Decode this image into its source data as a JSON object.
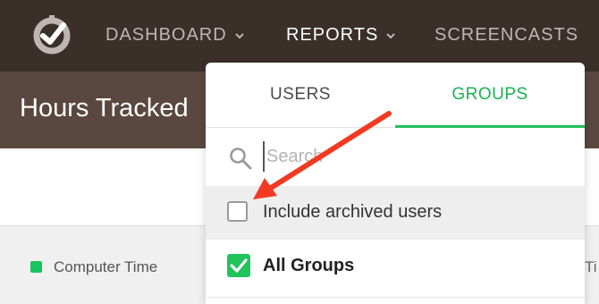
{
  "nav": {
    "items": [
      {
        "label": "DASHBOARD",
        "has_dropdown": true,
        "active": false
      },
      {
        "label": "REPORTS",
        "has_dropdown": true,
        "active": true
      },
      {
        "label": "SCREENCASTS",
        "has_dropdown": false,
        "active": false
      }
    ]
  },
  "page": {
    "title": "Hours Tracked"
  },
  "legend": {
    "computer_time_label": "Computer Time",
    "computer_time_color": "#19c35f",
    "right_partial": "Ti"
  },
  "dropdown": {
    "tabs": [
      {
        "label": "USERS",
        "active": false
      },
      {
        "label": "GROUPS",
        "active": true
      }
    ],
    "search": {
      "placeholder": "Search",
      "value": ""
    },
    "include_archived": {
      "label": "Include archived users",
      "checked": false
    },
    "all_groups": {
      "label": "All Groups",
      "checked": true
    }
  },
  "colors": {
    "accent_green": "#1fbf5a",
    "nav_bg": "#3b2f2a",
    "annotation_arrow": "#f23a22"
  }
}
